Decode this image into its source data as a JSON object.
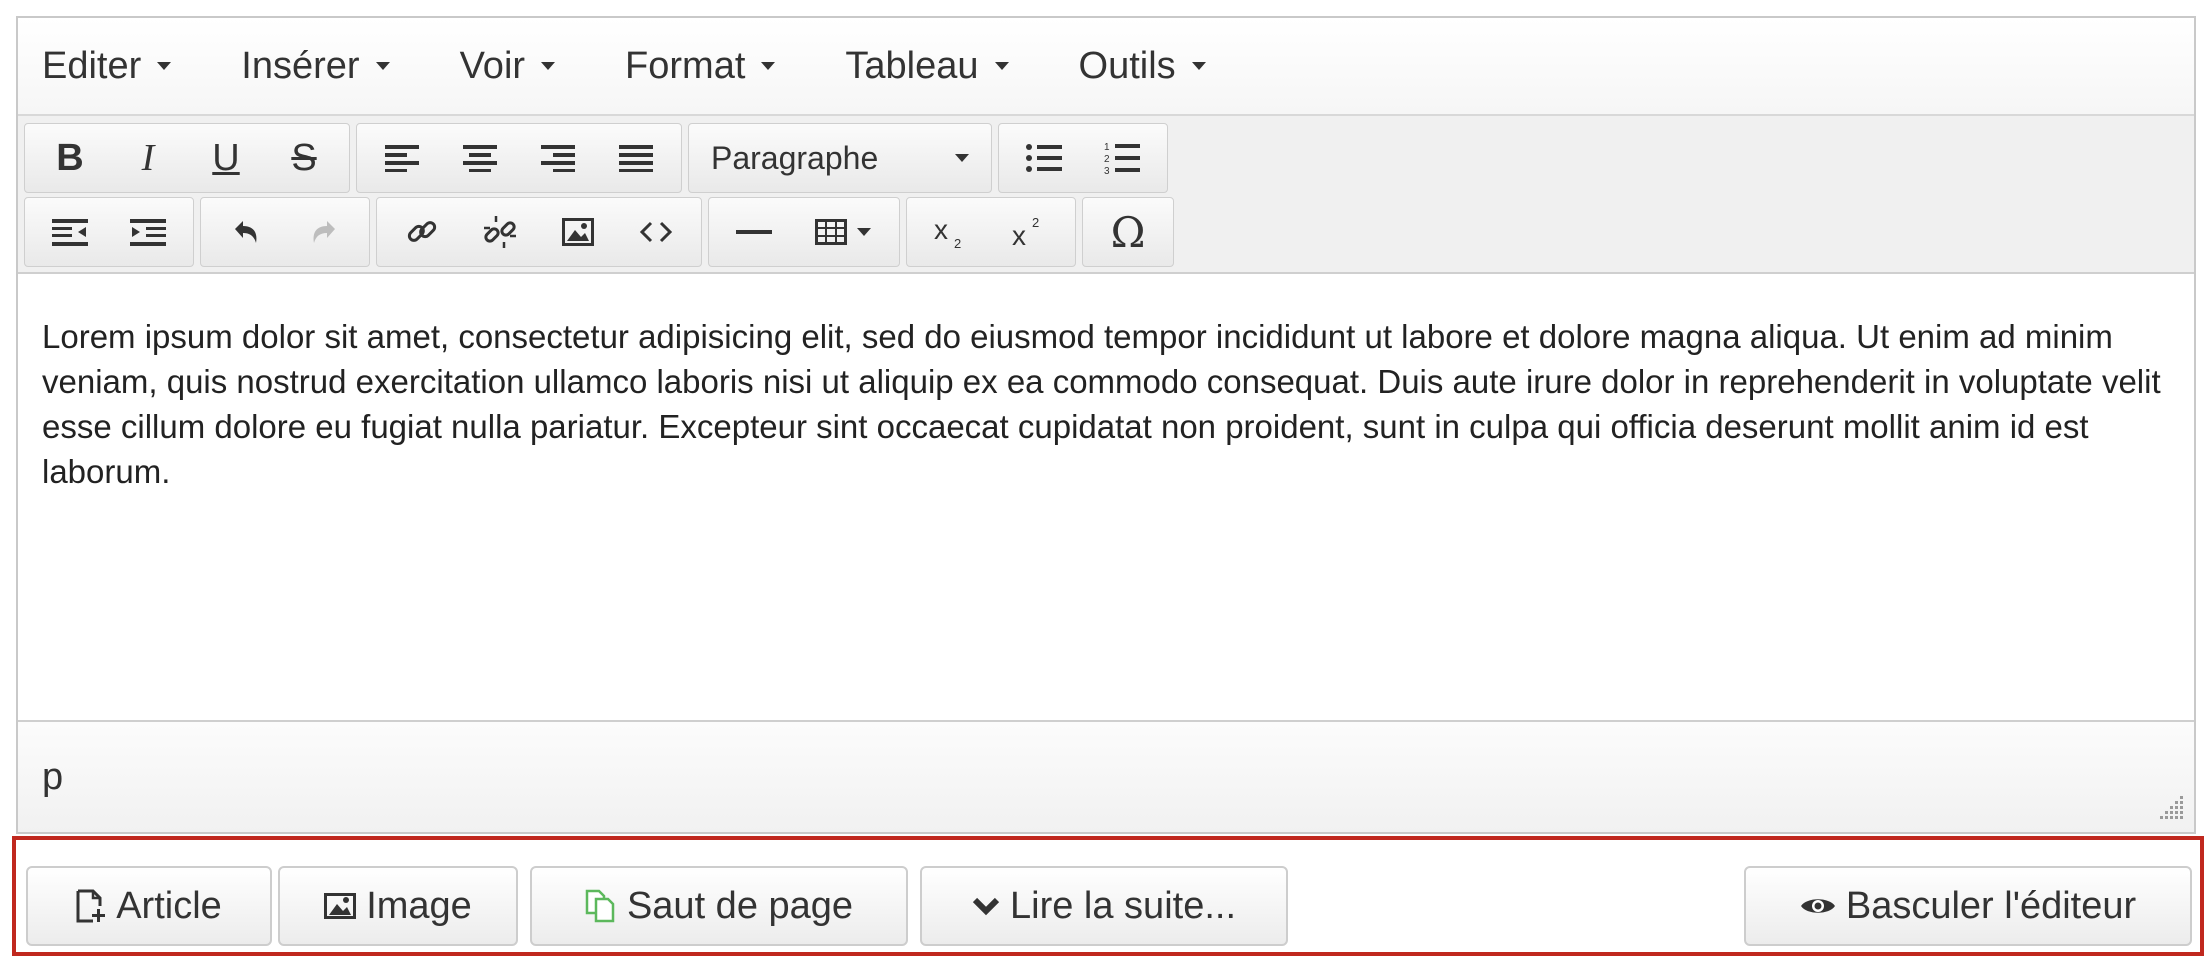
{
  "menubar": {
    "items": [
      {
        "label": "Editer"
      },
      {
        "label": "Insérer"
      },
      {
        "label": "Voir"
      },
      {
        "label": "Format"
      },
      {
        "label": "Tableau"
      },
      {
        "label": "Outils"
      }
    ]
  },
  "toolbar": {
    "bold": "B",
    "italic": "I",
    "underline": "U",
    "strikethrough": "S",
    "format_select": "Paragraphe",
    "omega": "Ω"
  },
  "content": {
    "paragraph": "Lorem ipsum dolor sit amet, consectetur adipisicing elit, sed do eiusmod tempor incididunt ut labore et dolore magna aliqua. Ut enim ad minim veniam, quis nostrud exercitation ullamco laboris nisi ut aliquip ex ea commodo consequat. Duis aute irure dolor in reprehenderit in voluptate velit esse cillum dolore eu fugiat nulla pariatur. Excepteur sint occaecat cupidatat non proident, sunt in culpa qui officia deserunt mollit anim id est laborum."
  },
  "statusbar": {
    "path": "p"
  },
  "buttons": {
    "article": "Article",
    "image": "Image",
    "pagebreak": "Saut de page",
    "readmore": "Lire la suite...",
    "toggle": "Basculer l'éditeur"
  },
  "colors": {
    "highlight_border": "#c0281e",
    "pagebreak_icon": "#5cb85c"
  }
}
